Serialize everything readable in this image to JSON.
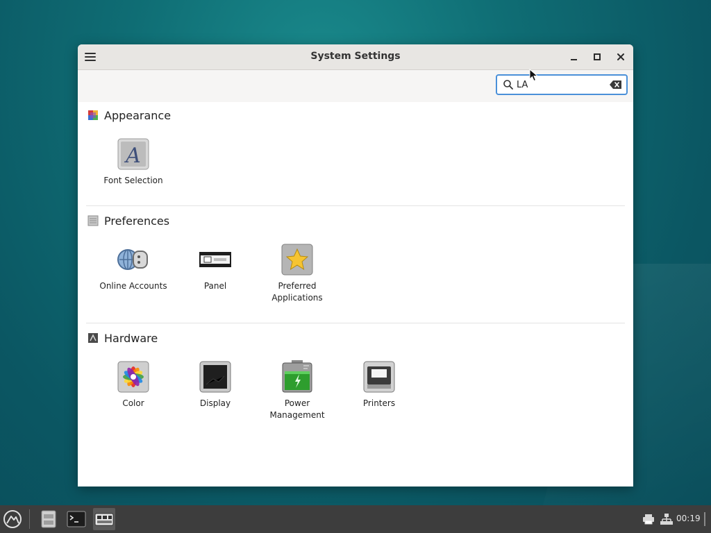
{
  "window": {
    "title": "System Settings"
  },
  "search": {
    "value": "LA",
    "placeholder": ""
  },
  "sections": [
    {
      "title": "Appearance",
      "items": [
        {
          "label": "Font Selection",
          "icon": "font-selection-icon"
        }
      ]
    },
    {
      "title": "Preferences",
      "items": [
        {
          "label": "Online Accounts",
          "icon": "online-accounts-icon"
        },
        {
          "label": "Panel",
          "icon": "panel-icon"
        },
        {
          "label": "Preferred Applications",
          "icon": "preferred-applications-icon"
        }
      ]
    },
    {
      "title": "Hardware",
      "items": [
        {
          "label": "Color",
          "icon": "color-icon"
        },
        {
          "label": "Display",
          "icon": "display-icon"
        },
        {
          "label": "Power Management",
          "icon": "power-management-icon"
        },
        {
          "label": "Printers",
          "icon": "printers-icon"
        }
      ]
    }
  ],
  "taskbar": {
    "clock": "00:19",
    "apps": [
      "start-menu-icon",
      "file-manager-icon",
      "terminal-icon",
      "system-settings-icon"
    ],
    "tray": [
      "printer-icon",
      "network-icon"
    ]
  },
  "colors": {
    "accent": "#4a90d9",
    "titlebar": "#e8e6e3",
    "taskbar": "#3d3d3d",
    "desktop": "#0f6d74"
  }
}
